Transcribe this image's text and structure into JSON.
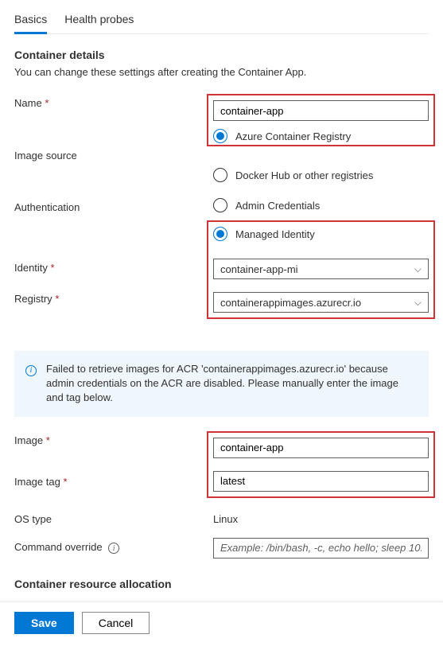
{
  "tabs": {
    "basics": "Basics",
    "health": "Health probes"
  },
  "section": {
    "title": "Container details",
    "sub": "You can change these settings after creating the Container App."
  },
  "labels": {
    "name": "Name",
    "imageSource": "Image source",
    "auth": "Authentication",
    "identity": "Identity",
    "registry": "Registry",
    "image": "Image",
    "imageTag": "Image tag",
    "osType": "OS type",
    "cmdOverride": "Command override"
  },
  "values": {
    "name": "container-app",
    "identity": "container-app-mi",
    "registry": "containerappimages.azurecr.io",
    "image": "container-app",
    "imageTag": "latest",
    "osType": "Linux",
    "cmdPlaceholder": "Example: /bin/bash, -c, echo hello; sleep 10..."
  },
  "radios": {
    "acr": "Azure Container Registry",
    "docker": "Docker Hub or other registries",
    "adminCred": "Admin Credentials",
    "managed": "Managed Identity"
  },
  "info": "Failed to retrieve images for ACR 'containerappimages.azurecr.io' because admin credentials on the ACR are disabled. Please manually enter the image and tag below.",
  "resourceSection": "Container resource allocation",
  "buttons": {
    "save": "Save",
    "cancel": "Cancel"
  }
}
